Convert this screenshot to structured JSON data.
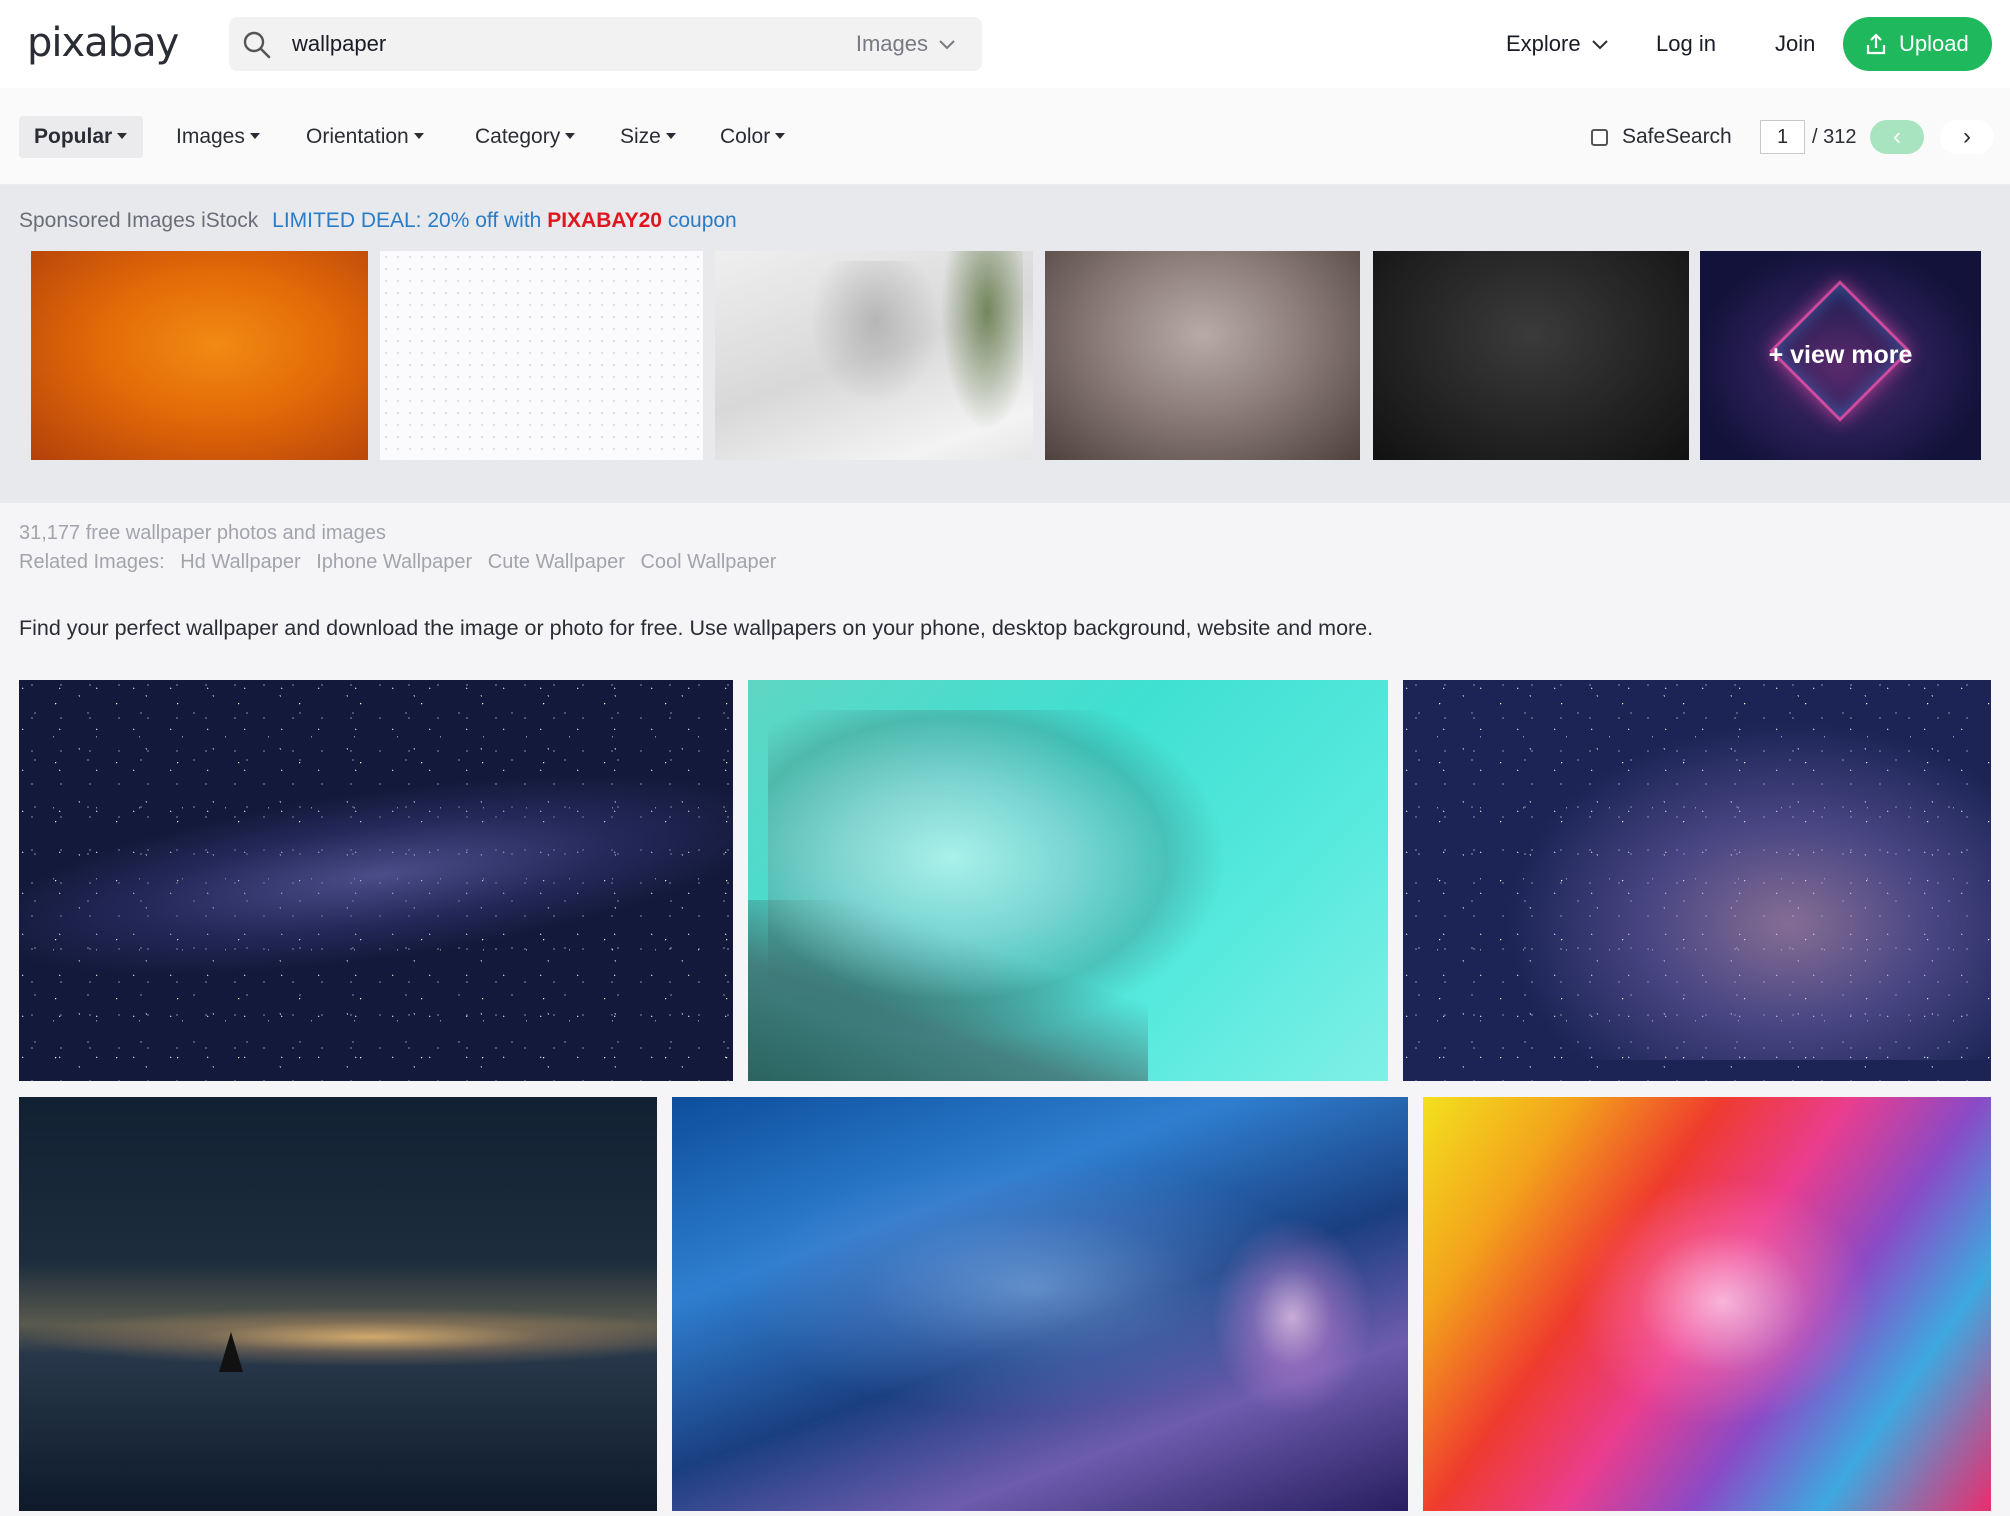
{
  "header": {
    "logo": "pixabay",
    "search": {
      "query": "wallpaper",
      "type": "Images"
    },
    "nav": {
      "explore": "Explore",
      "login": "Log in",
      "join": "Join",
      "upload": "Upload"
    }
  },
  "filters": {
    "items": [
      "Popular",
      "Images",
      "Orientation",
      "Category",
      "Size",
      "Color"
    ],
    "safesearch": {
      "label": "SafeSearch",
      "checked": false
    },
    "pagination": {
      "current": "1",
      "total": "/ 312",
      "prev": "‹",
      "next": "›"
    }
  },
  "sponsored": {
    "label": "Sponsored Images iStock",
    "deal_prefix": "LIMITED DEAL: 20% off with",
    "deal_code": "PIXABAY20",
    "deal_suffix": "coupon",
    "view_more": "+ view more"
  },
  "results": {
    "count": "31,177 free wallpaper photos and images",
    "related_label": "Related Images:",
    "related": [
      "Hd Wallpaper",
      "Iphone Wallpaper",
      "Cute Wallpaper",
      "Cool Wallpaper"
    ],
    "description": "Find your perfect wallpaper and download the image or photo for free. Use wallpapers on your phone, desktop background, website and more."
  },
  "colors": {
    "accent_green": "#20b85d",
    "deal_blue": "#2a7cc7",
    "coupon_red": "#e0161e"
  }
}
